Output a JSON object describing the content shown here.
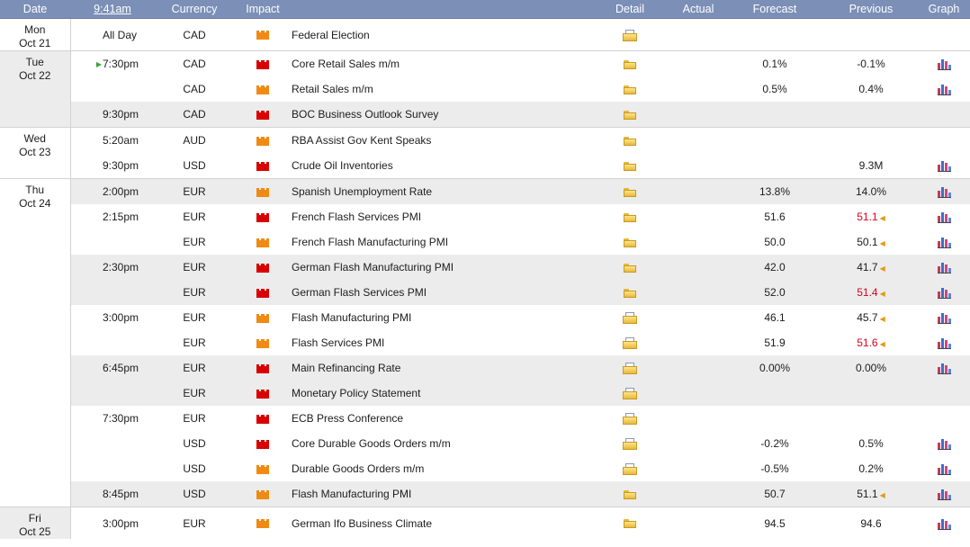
{
  "headers": {
    "date": "Date",
    "time": "9:41am",
    "currency": "Currency",
    "impact": "Impact",
    "event": "",
    "detail": "Detail",
    "actual": "Actual",
    "forecast": "Forecast",
    "previous": "Previous",
    "graph": "Graph"
  },
  "colors": {
    "header_bg": "#7b8fb7",
    "row_shade": "#ececec",
    "high_impact": "#d90000",
    "medium_impact": "#f08a12",
    "revised_value": "#d8001c"
  },
  "rows": [
    {
      "day": "Mon",
      "date": "Oct 21",
      "time": "All Day",
      "currency": "CAD",
      "impact": "orange",
      "event": "Federal Election",
      "detail": "folder-doc",
      "actual": "",
      "forecast": "",
      "previous": "",
      "graph": false
    },
    {
      "day": "Tue",
      "date": "Oct 22",
      "time": "7:30pm",
      "currency": "CAD",
      "impact": "red",
      "event": "Core Retail Sales m/m",
      "detail": "folder",
      "actual": "",
      "forecast": "0.1%",
      "previous": "-0.1%",
      "graph": true
    },
    {
      "day": "",
      "date": "",
      "time": "",
      "currency": "CAD",
      "impact": "orange",
      "event": "Retail Sales m/m",
      "detail": "folder",
      "actual": "",
      "forecast": "0.5%",
      "previous": "0.4%",
      "graph": true
    },
    {
      "day": "",
      "date": "",
      "time": "9:30pm",
      "currency": "CAD",
      "impact": "red",
      "event": "BOC Business Outlook Survey",
      "detail": "folder",
      "actual": "",
      "forecast": "",
      "previous": "",
      "graph": false
    },
    {
      "day": "Wed",
      "date": "Oct 23",
      "time": "5:20am",
      "currency": "AUD",
      "impact": "orange",
      "event": "RBA Assist Gov Kent Speaks",
      "detail": "folder",
      "actual": "",
      "forecast": "",
      "previous": "",
      "graph": false
    },
    {
      "day": "",
      "date": "",
      "time": "9:30pm",
      "currency": "USD",
      "impact": "red",
      "event": "Crude Oil Inventories",
      "detail": "folder",
      "actual": "",
      "forecast": "",
      "previous": "9.3M",
      "graph": true
    },
    {
      "day": "Thu",
      "date": "Oct 24",
      "time": "2:00pm",
      "currency": "EUR",
      "impact": "orange",
      "event": "Spanish Unemployment Rate",
      "detail": "folder",
      "actual": "",
      "forecast": "13.8%",
      "previous": "14.0%",
      "graph": true
    },
    {
      "day": "",
      "date": "",
      "time": "2:15pm",
      "currency": "EUR",
      "impact": "red",
      "event": "French Flash Services PMI",
      "detail": "folder",
      "actual": "",
      "forecast": "51.6",
      "previous": "51.1",
      "graph": true
    },
    {
      "day": "",
      "date": "",
      "time": "",
      "currency": "EUR",
      "impact": "orange",
      "event": "French Flash Manufacturing PMI",
      "detail": "folder",
      "actual": "",
      "forecast": "50.0",
      "previous": "50.1",
      "graph": true
    },
    {
      "day": "",
      "date": "",
      "time": "2:30pm",
      "currency": "EUR",
      "impact": "red",
      "event": "German Flash Manufacturing PMI",
      "detail": "folder",
      "actual": "",
      "forecast": "42.0",
      "previous": "41.7",
      "graph": true
    },
    {
      "day": "",
      "date": "",
      "time": "",
      "currency": "EUR",
      "impact": "red",
      "event": "German Flash Services PMI",
      "detail": "folder",
      "actual": "",
      "forecast": "52.0",
      "previous": "51.4",
      "graph": true
    },
    {
      "day": "",
      "date": "",
      "time": "3:00pm",
      "currency": "EUR",
      "impact": "orange",
      "event": "Flash Manufacturing PMI",
      "detail": "folder-doc",
      "actual": "",
      "forecast": "46.1",
      "previous": "45.7",
      "graph": true
    },
    {
      "day": "",
      "date": "",
      "time": "",
      "currency": "EUR",
      "impact": "orange",
      "event": "Flash Services PMI",
      "detail": "folder-doc",
      "actual": "",
      "forecast": "51.9",
      "previous": "51.6",
      "graph": true
    },
    {
      "day": "",
      "date": "",
      "time": "6:45pm",
      "currency": "EUR",
      "impact": "red",
      "event": "Main Refinancing Rate",
      "detail": "folder-doc",
      "actual": "",
      "forecast": "0.00%",
      "previous": "0.00%",
      "graph": true
    },
    {
      "day": "",
      "date": "",
      "time": "",
      "currency": "EUR",
      "impact": "red",
      "event": "Monetary Policy Statement",
      "detail": "folder-doc",
      "actual": "",
      "forecast": "",
      "previous": "",
      "graph": false
    },
    {
      "day": "",
      "date": "",
      "time": "7:30pm",
      "currency": "EUR",
      "impact": "red",
      "event": "ECB Press Conference",
      "detail": "folder-doc",
      "actual": "",
      "forecast": "",
      "previous": "",
      "graph": false
    },
    {
      "day": "",
      "date": "",
      "time": "",
      "currency": "USD",
      "impact": "red",
      "event": "Core Durable Goods Orders m/m",
      "detail": "folder-doc",
      "actual": "",
      "forecast": "-0.2%",
      "previous": "0.5%",
      "graph": true
    },
    {
      "day": "",
      "date": "",
      "time": "",
      "currency": "USD",
      "impact": "orange",
      "event": "Durable Goods Orders m/m",
      "detail": "folder-doc",
      "actual": "",
      "forecast": "-0.5%",
      "previous": "0.2%",
      "graph": true
    },
    {
      "day": "",
      "date": "",
      "time": "8:45pm",
      "currency": "USD",
      "impact": "orange",
      "event": "Flash Manufacturing PMI",
      "detail": "folder",
      "actual": "",
      "forecast": "50.7",
      "previous": "51.1",
      "graph": true
    },
    {
      "day": "Fri",
      "date": "Oct 25",
      "time": "3:00pm",
      "currency": "EUR",
      "impact": "orange",
      "event": "German Ifo Business Climate",
      "detail": "folder",
      "actual": "",
      "forecast": "94.5",
      "previous": "94.6",
      "graph": true
    }
  ]
}
